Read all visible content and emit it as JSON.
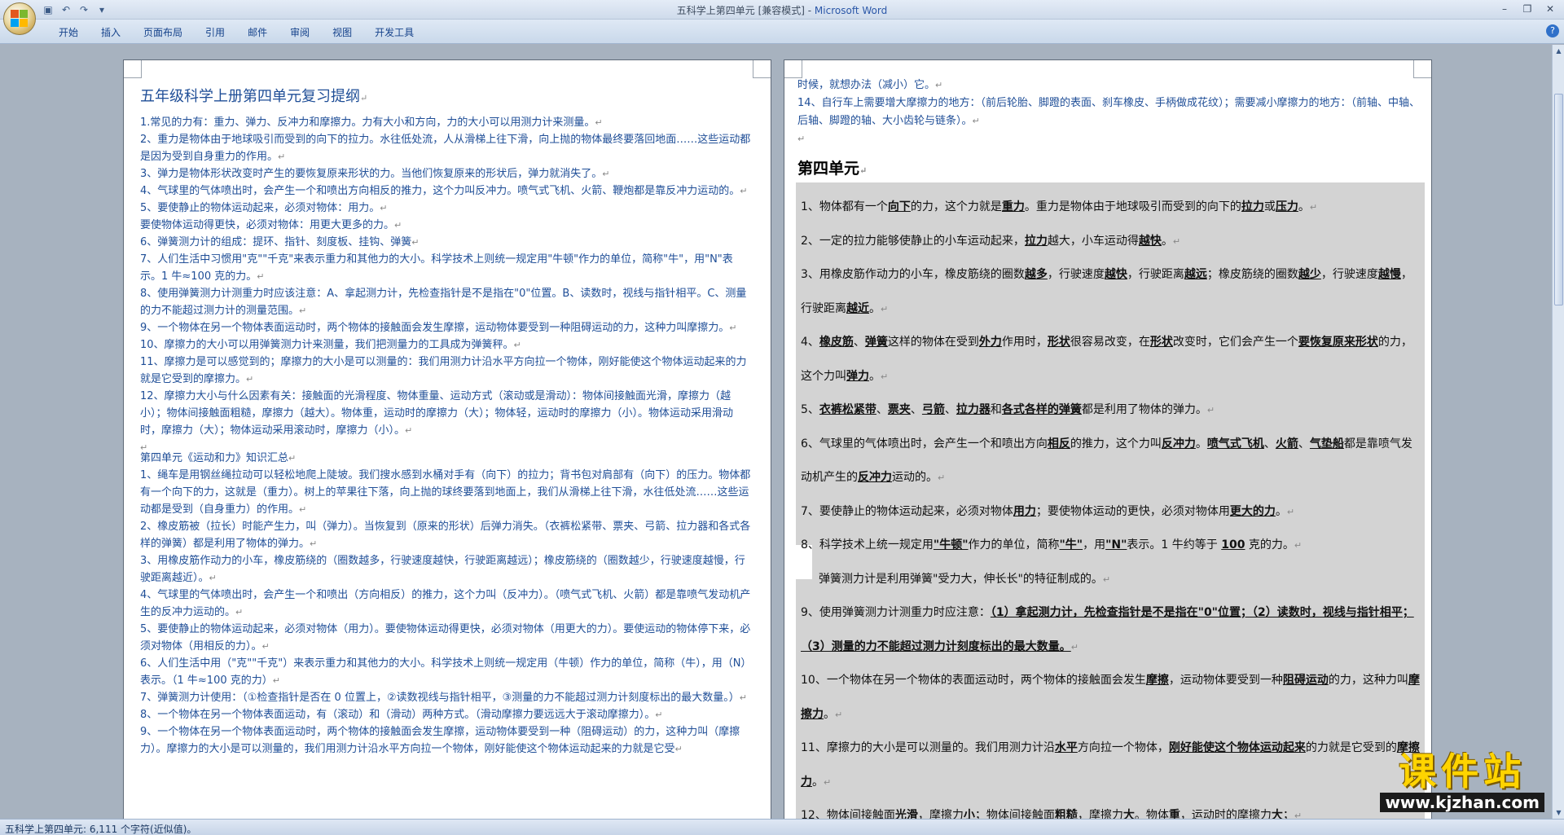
{
  "window": {
    "title": "五科学上第四单元 [兼容模式] - ",
    "app_name": "Microsoft Word"
  },
  "ribbon": {
    "tabs": [
      "开始",
      "插入",
      "页面布局",
      "引用",
      "邮件",
      "审阅",
      "视图",
      "开发工具"
    ]
  },
  "page1": {
    "title": "五年级科学上册第四单元复习提纲",
    "paragraphs": [
      "1.常见的力有：重力、弹力、反冲力和摩擦力。力有大小和方向，力的大小可以用测力计来测量。",
      "2、重力是物体由于地球吸引而受到的向下的拉力。水往低处流，人从滑梯上往下滑，向上抛的物体最终要落回地面……这些运动都是因为受到自身重力的作用。",
      "3、弹力是物体形状改变时产生的要恢复原来形状的力。当他们恢复原来的形状后，弹力就消失了。",
      "4、气球里的气体喷出时，会产生一个和喷出方向相反的推力，这个力叫反冲力。喷气式飞机、火箭、鞭炮都是靠反冲力运动的。",
      "5、要使静止的物体运动起来，必须对物体：用力。",
      "要使物体运动得更快，必须对物体：用更大更多的力。",
      "6、弹簧测力计的组成：提环、指针、刻度板、挂钩、弹簧",
      "7、人们生活中习惯用\"克\"\"千克\"来表示重力和其他力的大小。科学技术上则统一规定用\"牛顿\"作力的单位，简称\"牛\"，用\"N\"表示。1 牛≈100 克的力。",
      "8、使用弹簧测力计测重力时应该注意：A、拿起测力计，先检查指针是不是指在\"0\"位置。B、读数时，视线与指针相平。C、测量的力不能超过测力计的测量范围。",
      "9、一个物体在另一个物体表面运动时，两个物体的接触面会发生摩擦，运动物体要受到一种阻碍运动的力，这种力叫摩擦力。",
      "10、摩擦力的大小可以用弹簧测力计来测量，我们把测量力的工具成为弹簧秤。",
      "11、摩擦力是可以感觉到的；摩擦力的大小是可以测量的：我们用测力计沿水平方向拉一个物体，刚好能使这个物体运动起来的力就是它受到的摩擦力。",
      "12、摩擦力大小与什么因素有关：接触面的光滑程度、物体重量、运动方式（滚动或是滑动）：物体间接触面光滑，摩擦力（越小）；物体间接触面粗糙，摩擦力（越大）。物体重，运动时的摩擦力（大）；物体轻，运动时的摩擦力（小）。物体运动采用滑动时，摩擦力（大）；物体运动采用滚动时，摩擦力（小）。",
      "",
      "第四单元《运动和力》知识汇总",
      "1、绳车是用钢丝绳拉动可以轻松地爬上陡坡。我们搜水感到水桶对手有（向下）的拉力；背书包对肩部有（向下）的压力。物体都有一个向下的力，这就是（重力）。树上的苹果往下落，向上抛的球终要落到地面上，我们从滑梯上往下滑，水往低处流……这些运动都是受到（自身重力）的作用。",
      "2、橡皮筋被（拉长）时能产生力，叫（弹力）。当恢复到（原来的形状）后弹力消失。（衣裤松紧带、票夹、弓箭、拉力器和各式各样的弹簧）都是利用了物体的弹力。",
      "3、用橡皮筋作动力的小车，橡皮筋绕的（圈数越多，行驶速度越快，行驶距离越远）；橡皮筋绕的（圈数越少，行驶速度越慢，行驶距离越近）。",
      "4、气球里的气体喷出时，会产生一个和喷出（方向相反）的推力，这个力叫（反冲力）。（喷气式飞机、火箭）都是靠喷气发动机产生的反冲力运动的。",
      "5、要使静止的物体运动起来，必须对物体（用力）。要使物体运动得更快，必须对物体（用更大的力）。要使运动的物体停下来，必须对物体（用相反的力）。",
      "6、人们生活中用（\"克\"\"千克\"）来表示重力和其他力的大小。科学技术上则统一规定用（牛顿）作力的单位，简称（牛），用（N）表示。（1 牛≈100 克的力）",
      "7、弹簧测力计使用：（①检查指针是否在 0 位置上，②读数视线与指针相平，③测量的力不能超过测力计刻度标出的最大数量。）",
      "8、一个物体在另一个物体表面运动，有（滚动）和（滑动）两种方式。（滑动摩擦力要远远大于滚动摩擦力）。",
      "9、一个物体在另一个物体表面运动时，两个物体的接触面会发生摩擦，运动物体要受到一种（阻碍运动）的力，这种力叫（摩擦力）。摩擦力的大小是可以测量的，我们用测力计沿水平方向拉一个物体，刚好能使这个物体运动起来的力就是它受"
    ]
  },
  "page2": {
    "top_lines": [
      "时候，就想办法（减小）它。",
      "14、自行车上需要增大摩擦力的地方：（前后轮胎、脚蹬的表面、刹车橡皮、手柄做成花纹）；需要减小摩擦力的地方：（前轴、中轴、后轴、脚蹬的轴、大小齿轮与链条）。",
      ""
    ],
    "heading": "第四单元",
    "items": [
      [
        "1、物体都有一个",
        "向下",
        "的力，这个力就是",
        "重力",
        "。重力是物体由于地球吸引而受到的向下的",
        "拉力",
        "或",
        "压力",
        "。"
      ],
      [
        "2、一定的拉力能够使静止的小车运动起来，",
        "拉力",
        "越大，小车运动得",
        "越快",
        "。"
      ],
      [
        "3、用橡皮筋作动力的小车，橡皮筋绕的圈数",
        "越多",
        "，行驶速度",
        "越快",
        "，行驶距离",
        "越远",
        "；橡皮筋绕的圈数",
        "越少",
        "，行驶速度",
        "越慢",
        "，行驶距离",
        "越近",
        "。"
      ],
      [
        "4、",
        "橡皮筋",
        "、",
        "弹簧",
        "这样的物体在受到",
        "外力",
        "作用时，",
        "形状",
        "很容易改变，在",
        "形状",
        "改变时，它们会产生一个",
        "要恢复原来形状",
        "的力，这个力叫",
        "弹力",
        "。"
      ],
      [
        "5、",
        "衣裤松紧带",
        "、",
        "票夹",
        "、",
        "弓箭",
        "、",
        "拉力器",
        "和",
        "各式各样的弹簧",
        "都是利用了物体的弹力。"
      ],
      [
        "6、气球里的气体喷出时，会产生一个和喷出方向",
        "相反",
        "的推力，这个力叫",
        "反冲力",
        "。",
        "喷气式飞机",
        "、",
        "火箭",
        "、",
        "气垫船",
        "都是靠喷气发动机产生的",
        "反冲力",
        "运动的。"
      ],
      [
        "7、要使静止的物体运动起来，必须对物体",
        "用力",
        "；要使物体运动的更快，必须对物体用",
        "更大的力",
        "。"
      ],
      [
        "8、科学技术上统一规定用",
        "\"牛顿\"",
        "作力的单位，简称",
        "\"牛\"",
        "，用",
        "\"N\"",
        "表示。1 牛约等于 ",
        "100",
        " 克的力。"
      ],
      [
        "弹簧测力计是利用弹簧\"受力大，伸长长\"的特征制成的。"
      ],
      [
        "9、使用弹簧测力计测重力时应注意：",
        "（1）拿起测力计，先检查指针是不是指在\"0\"位置；（2）读数时，视线与指针相平；（3）测量的力不能超过测力计刻度标出的最大数量。"
      ],
      [
        "10、一个物体在另一个物体的表面运动时，两个物体的接触面会发生",
        "摩擦",
        "，运动物体要受到一种",
        "阻碍运动",
        "的力，这种力叫",
        "摩擦力",
        "。"
      ],
      [
        "11、摩擦力的大小是可以测量的。我们用测力计沿",
        "水平",
        "方向拉一个物体，",
        "刚好能使这个物体运动起来",
        "的力就是它受到的",
        "摩擦力",
        "。"
      ],
      [
        "12、物体间接触面",
        "光滑",
        "，摩擦力",
        "小",
        "；物体间接触面",
        "粗糙",
        "，摩擦力",
        "大",
        "。物体",
        "重",
        "，运动时的摩擦力",
        "大",
        "；"
      ]
    ]
  },
  "status_bar": {
    "text": "五科学上第四单元: 6,111 个字符(近似值)。"
  },
  "watermark": {
    "main": "课件站",
    "url": "www.kjzhan.com"
  }
}
